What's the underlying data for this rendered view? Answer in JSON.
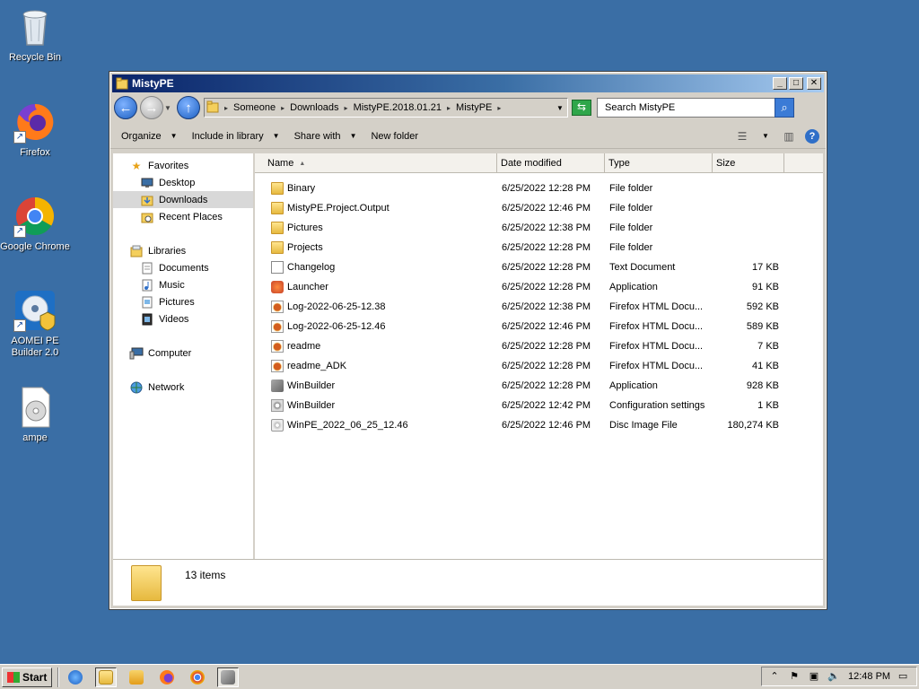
{
  "desktop": {
    "icons": [
      {
        "label": "Recycle Bin"
      },
      {
        "label": "Firefox"
      },
      {
        "label": "Google Chrome"
      },
      {
        "label": "AOMEI PE Builder 2.0"
      },
      {
        "label": "ampe"
      }
    ]
  },
  "window": {
    "title": "MistyPE",
    "breadcrumbs": [
      "Someone",
      "Downloads",
      "MistyPE.2018.01.21",
      "MistyPE"
    ],
    "search_placeholder": "Search MistyPE",
    "toolbar": {
      "organize": "Organize",
      "include_in_library": "Include in library",
      "share_with": "Share with",
      "new_folder": "New folder"
    },
    "nav": {
      "favorites": "Favorites",
      "favorites_items": [
        "Desktop",
        "Downloads",
        "Recent Places"
      ],
      "libraries": "Libraries",
      "libraries_items": [
        "Documents",
        "Music",
        "Pictures",
        "Videos"
      ],
      "computer": "Computer",
      "network": "Network"
    },
    "columns": [
      "Name",
      "Date modified",
      "Type",
      "Size"
    ],
    "files": [
      {
        "name": "Binary",
        "date": "6/25/2022 12:28 PM",
        "type": "File folder",
        "size": "",
        "icon": "folder-icon"
      },
      {
        "name": "MistyPE.Project.Output",
        "date": "6/25/2022 12:46 PM",
        "type": "File folder",
        "size": "",
        "icon": "folder-icon"
      },
      {
        "name": "Pictures",
        "date": "6/25/2022 12:38 PM",
        "type": "File folder",
        "size": "",
        "icon": "folder-icon"
      },
      {
        "name": "Projects",
        "date": "6/25/2022 12:28 PM",
        "type": "File folder",
        "size": "",
        "icon": "folder-icon"
      },
      {
        "name": "Changelog",
        "date": "6/25/2022 12:28 PM",
        "type": "Text Document",
        "size": "17 KB",
        "icon": "text-document-icon"
      },
      {
        "name": "Launcher",
        "date": "6/25/2022 12:28 PM",
        "type": "Application",
        "size": "91 KB",
        "icon": "application-icon"
      },
      {
        "name": "Log-2022-06-25-12.38",
        "date": "6/25/2022 12:38 PM",
        "type": "Firefox HTML Docu...",
        "size": "592 KB",
        "icon": "firefox-html-icon"
      },
      {
        "name": "Log-2022-06-25-12.46",
        "date": "6/25/2022 12:46 PM",
        "type": "Firefox HTML Docu...",
        "size": "589 KB",
        "icon": "firefox-html-icon"
      },
      {
        "name": "readme",
        "date": "6/25/2022 12:28 PM",
        "type": "Firefox HTML Docu...",
        "size": "7 KB",
        "icon": "firefox-html-icon"
      },
      {
        "name": "readme_ADK",
        "date": "6/25/2022 12:28 PM",
        "type": "Firefox HTML Docu...",
        "size": "41 KB",
        "icon": "firefox-html-icon"
      },
      {
        "name": "WinBuilder",
        "date": "6/25/2022 12:28 PM",
        "type": "Application",
        "size": "928 KB",
        "icon": "winbuilder-app-icon"
      },
      {
        "name": "WinBuilder",
        "date": "6/25/2022 12:42 PM",
        "type": "Configuration settings",
        "size": "1 KB",
        "icon": "config-settings-icon"
      },
      {
        "name": "WinPE_2022_06_25_12.46",
        "date": "6/25/2022 12:46 PM",
        "type": "Disc Image File",
        "size": "180,274 KB",
        "icon": "disc-image-icon"
      }
    ],
    "status": {
      "item_count": "13 items"
    }
  },
  "taskbar": {
    "start_label": "Start",
    "clock": "12:48 PM"
  }
}
